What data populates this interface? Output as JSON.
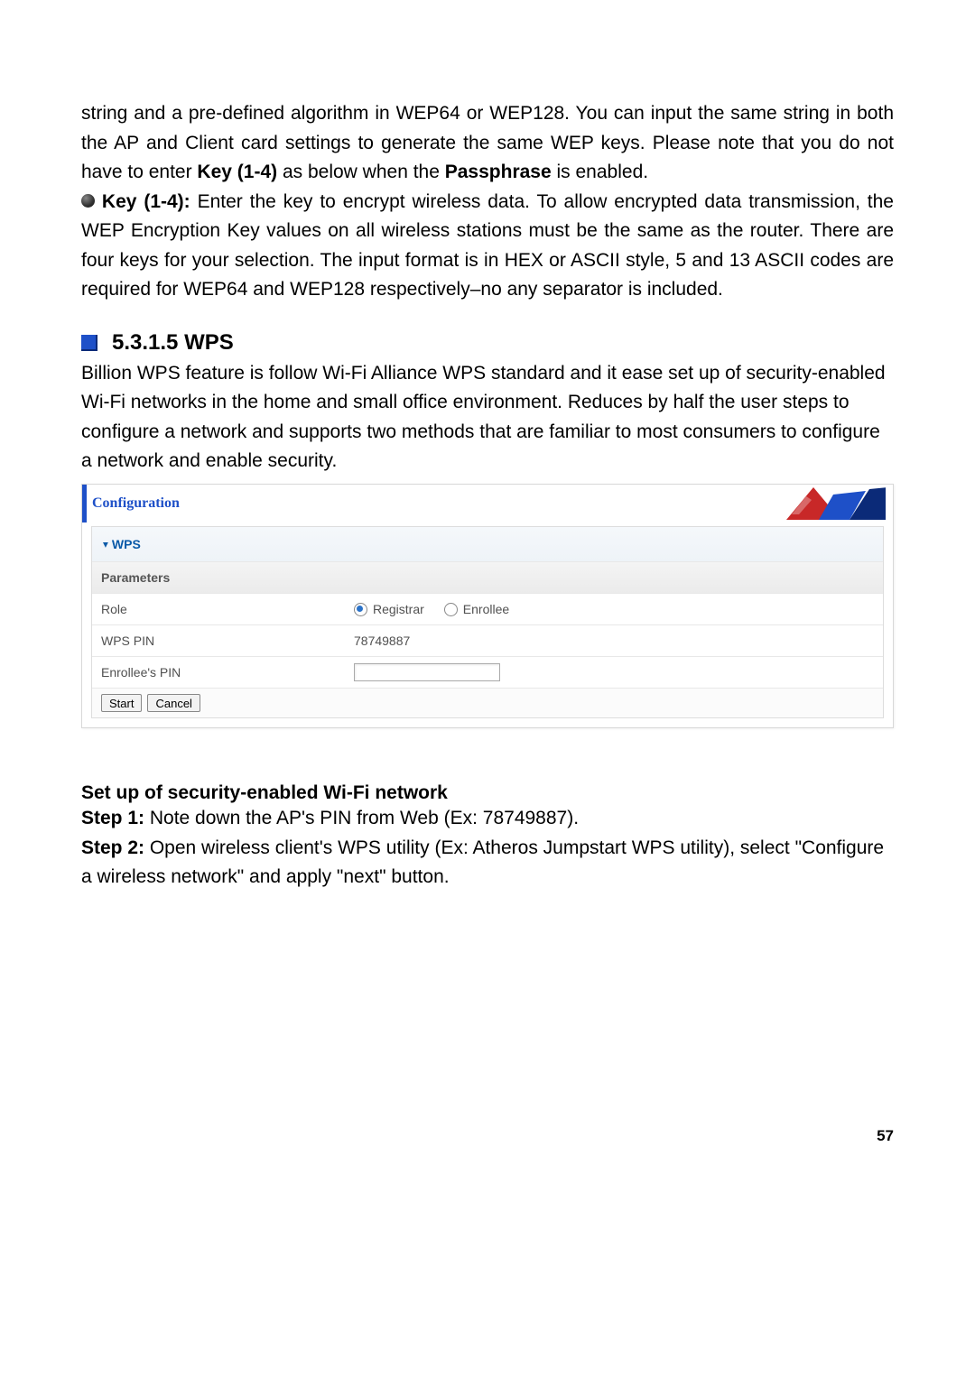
{
  "para1": "string and a pre-defined algorithm in WEP64 or WEP128. You can input the same string in both the AP and Client card settings to generate the same WEP keys. Please note that you do not have to enter ",
  "para1_bold1": "Key (1-4)",
  "para1_mid": " as below when the ",
  "para1_bold2": "Passphrase",
  "para1_end": " is enabled.",
  "bullet_label": "Key (1-4):",
  "bullet_text": " Enter the key to encrypt wireless data. To allow encrypted data transmission, the WEP Encryption Key values on all wireless stations must be the same as the router. There are four keys for your selection. The input format is in HEX or ASCII style, 5 and 13 ASCII codes are required for WEP64 and WEP128 respectively–no any separator is included.",
  "section_heading": "5.3.1.5 WPS",
  "wps_intro": "Billion WPS feature is follow Wi-Fi Alliance WPS standard and it ease set up of security-enabled Wi-Fi networks in the home and small office environment. Reduces by half the user steps to configure a network and supports two methods that are familiar to most consumers to configure a network and enable security.",
  "panel": {
    "title": "Configuration",
    "wps_header": "WPS",
    "params_header": "Parameters",
    "role_label": "Role",
    "registrar": "Registrar",
    "enrollee": "Enrollee",
    "wps_pin_label": "WPS PIN",
    "wps_pin_value": "78749887",
    "enrollee_pin_label": "Enrollee's PIN",
    "start": "Start",
    "cancel": "Cancel"
  },
  "setup_heading": "Set up of security-enabled Wi-Fi network",
  "step1_label": "Step 1:",
  "step1_text": " Note down the AP's PIN from Web (Ex: 78749887).",
  "step2_label": "Step 2:",
  "step2_text": " Open wireless client's WPS utility (Ex: Atheros Jumpstart WPS utility), select \"Configure a wireless network\" and apply \"next\" button.",
  "page_number": "57"
}
